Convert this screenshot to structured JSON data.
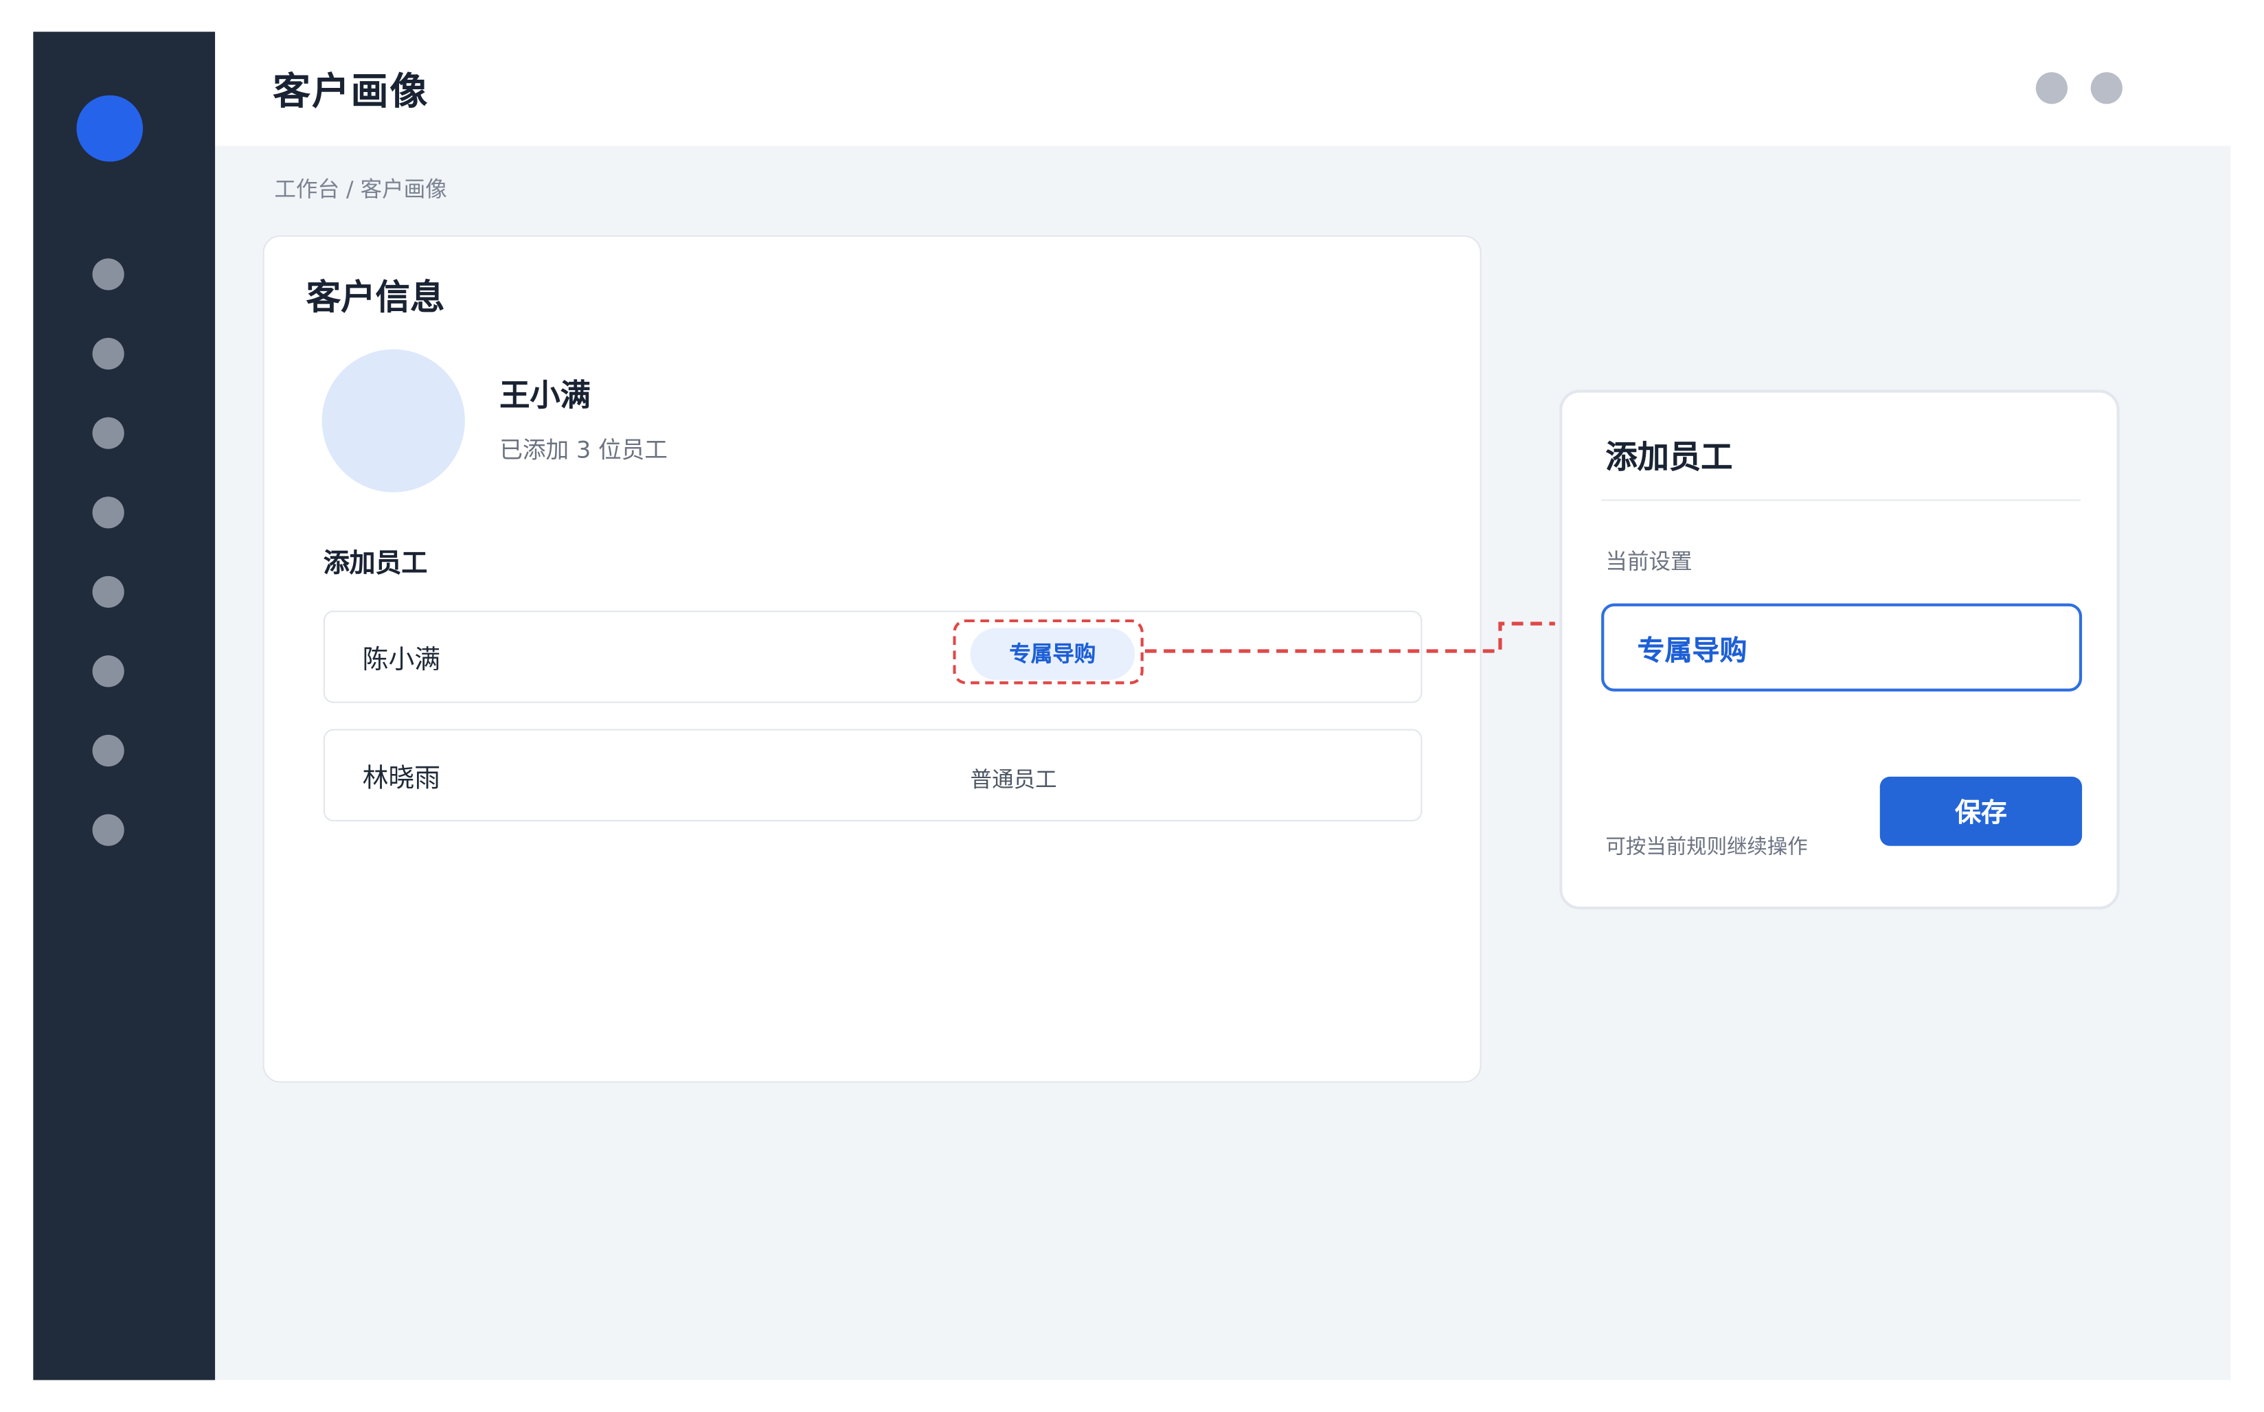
{
  "header": {
    "title": "客户画像"
  },
  "breadcrumb": "工作台 / 客户画像",
  "customer_card": {
    "title": "客户信息",
    "customer_name": "王小满",
    "customer_subtitle": "已添加 3 位员工",
    "section_title": "添加员工",
    "employees": [
      {
        "name": "陈小满",
        "role": "专属导购"
      },
      {
        "name": "林晓雨",
        "role": "普通员工"
      }
    ]
  },
  "side_panel": {
    "title": "添加员工",
    "field_label": "当前设置",
    "field_value": "专属导购",
    "hint": "可按当前规则继续操作",
    "save_label": "保存"
  },
  "colors": {
    "sidebar": "#202b3b",
    "accent": "#2563eb",
    "button": "#2466d8",
    "highlight": "#e04848",
    "content_bg": "#f2f5f8"
  }
}
